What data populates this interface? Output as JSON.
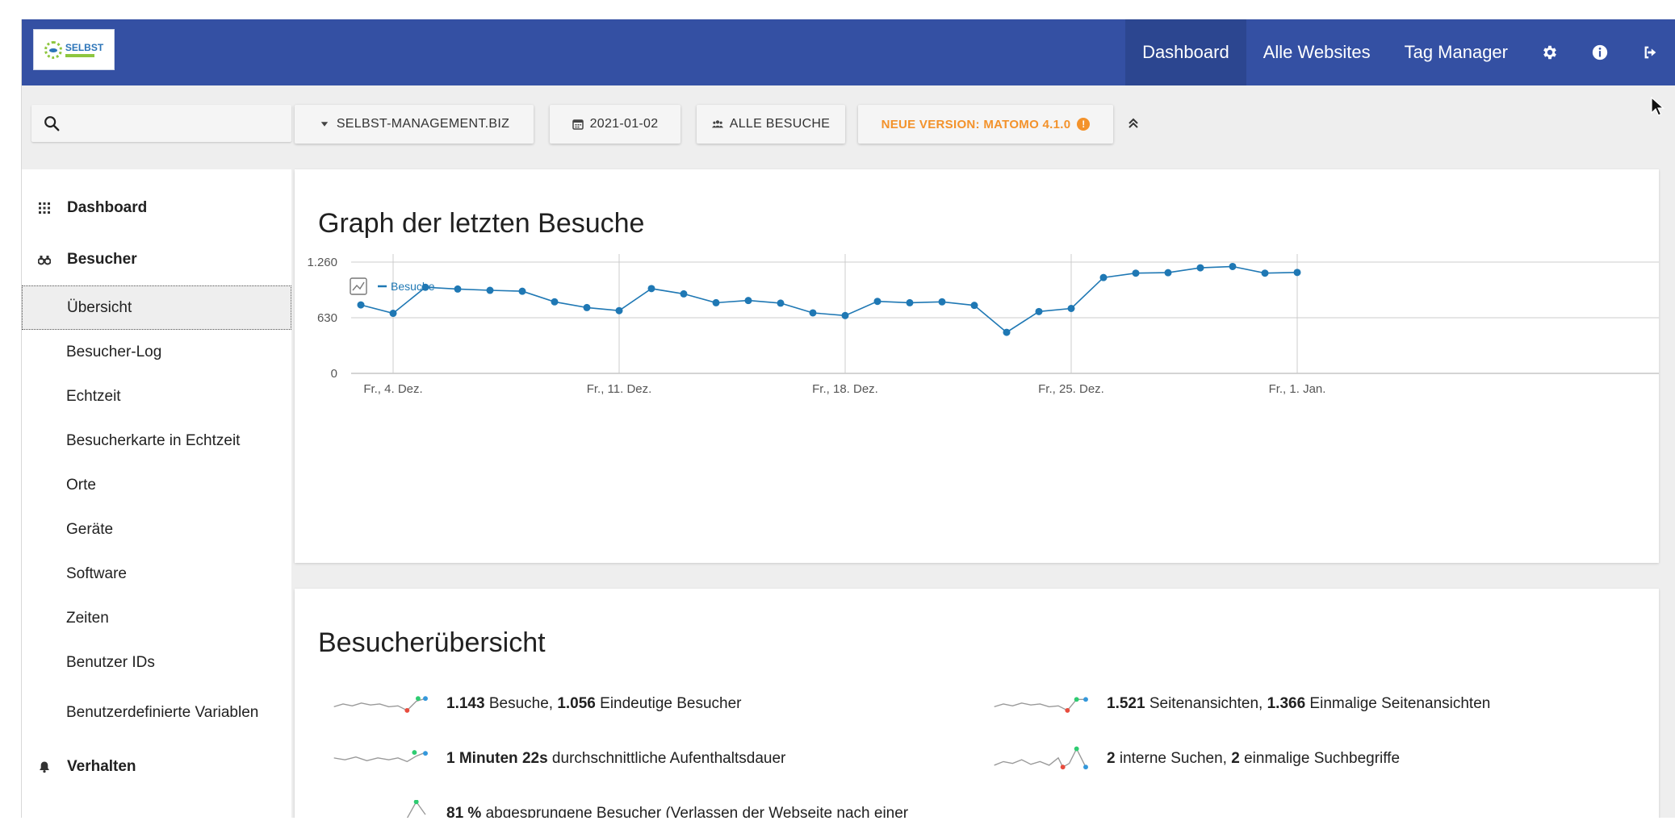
{
  "header": {
    "logo_text": "SELBST",
    "nav": [
      "Dashboard",
      "Alle Websites",
      "Tag Manager"
    ],
    "icons": [
      "gear-icon",
      "info-icon",
      "logout-icon"
    ]
  },
  "toolbar": {
    "search_placeholder": "",
    "site": "SELBST-MANAGEMENT.BIZ",
    "date": "2021-01-02",
    "segment": "ALLE BESUCHE",
    "version": "NEUE VERSION: MATOMO 4.1.0"
  },
  "sidebar": {
    "sections": [
      {
        "label": "Dashboard",
        "icon": "grid-icon"
      },
      {
        "label": "Besucher",
        "icon": "binoculars-icon"
      },
      {
        "label": "Verhalten",
        "icon": "bell-icon"
      }
    ],
    "visitor_items": [
      "Übersicht",
      "Besucher-Log",
      "Echtzeit",
      "Besucherkarte in Echtzeit",
      "Orte",
      "Geräte",
      "Software",
      "Zeiten",
      "Benutzer IDs",
      "Benutzerdefinierte Variablen"
    ]
  },
  "graph_card": {
    "title": "Graph der letzten Besuche"
  },
  "chart_data": {
    "type": "line",
    "legend": "Besuche",
    "y_ticks": [
      "1.260",
      "630",
      "0"
    ],
    "ylim": [
      0,
      1260
    ],
    "x_tick_labels": [
      "Fr., 4. Dez.",
      "Fr., 11. Dez.",
      "Fr., 18. Dez.",
      "Fr., 25. Dez.",
      "Fr., 1. Jan."
    ],
    "x_tick_index": [
      1,
      8,
      15,
      22,
      29
    ],
    "series": [
      {
        "name": "Besuche",
        "color": "#1f78b4",
        "values": [
          775,
          680,
          975,
          955,
          940,
          930,
          810,
          745,
          710,
          960,
          900,
          800,
          825,
          795,
          685,
          655,
          815,
          800,
          810,
          770,
          465,
          700,
          735,
          1085,
          1135,
          1140,
          1195,
          1210,
          1135,
          1143
        ]
      }
    ],
    "grid": true
  },
  "overview_card": {
    "title": "Besucherübersicht",
    "stats": [
      {
        "b1": "1.143",
        "t1": " Besuche, ",
        "b2": "1.056",
        "t2": " Eindeutige Besucher"
      },
      {
        "b1": "1.521",
        "t1": " Seitenansichten, ",
        "b2": "1.366",
        "t2": " Einmalige Seitenansichten"
      },
      {
        "b1": "1 Minuten 22s",
        "t1": " durchschnittliche Aufenthaltsdauer",
        "b2": "",
        "t2": ""
      },
      {
        "b1": "2",
        "t1": " interne Suchen, ",
        "b2": "2",
        "t2": " einmalige Suchbegriffe"
      },
      {
        "b1": "81 %",
        "t1": " abgesprungene Besucher (Verlassen der Webseite nach einer",
        "b2": "",
        "t2": ""
      }
    ]
  }
}
